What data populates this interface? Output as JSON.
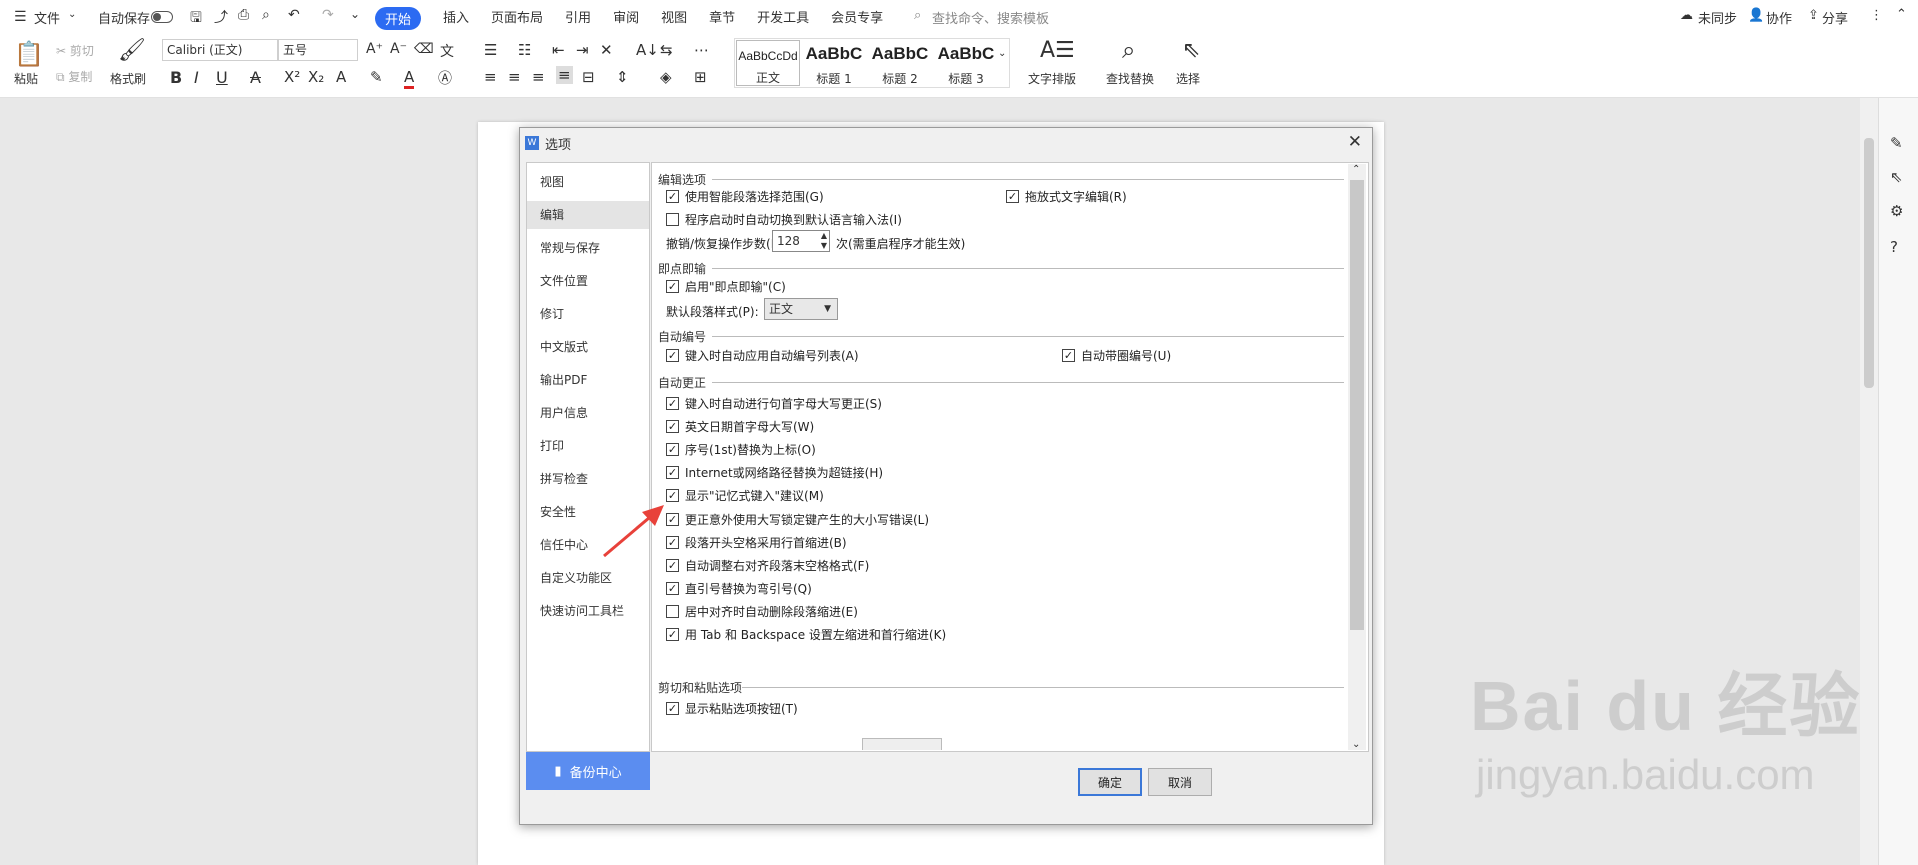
{
  "topbar": {
    "file": "文件",
    "autosave": "自动保存",
    "tabs": [
      "开始",
      "插入",
      "页面布局",
      "引用",
      "审阅",
      "视图",
      "章节",
      "开发工具",
      "会员专享"
    ],
    "search_placeholder": "查找命令、搜索模板",
    "sync": "未同步",
    "collab": "协作",
    "share": "分享"
  },
  "ribbon": {
    "paste": "粘贴",
    "cut": "剪切",
    "copy": "复制",
    "format_painter": "格式刷",
    "font": "Calibri (正文)",
    "size": "五号",
    "styles": [
      {
        "sample": "AaBbCcDd",
        "label": "正文"
      },
      {
        "sample": "AaBbC",
        "label": "标题 1"
      },
      {
        "sample": "AaBbC",
        "label": "标题 2"
      },
      {
        "sample": "AaBbC",
        "label": "标题 3"
      }
    ],
    "text_layout": "文字排版",
    "find_replace": "查找替换",
    "select": "选择"
  },
  "dialog": {
    "title": "选项",
    "nav": [
      "视图",
      "编辑",
      "常规与保存",
      "文件位置",
      "修订",
      "中文版式",
      "输出PDF",
      "用户信息",
      "打印",
      "拼写检查",
      "安全性",
      "信任中心",
      "自定义功能区",
      "快速访问工具栏"
    ],
    "backup": "备份中心",
    "sections": {
      "edit": "编辑选项",
      "click_type": "即点即输",
      "auto_number": "自动编号",
      "auto_correct": "自动更正",
      "cut_paste": "剪切和粘贴选项"
    },
    "edit_options": {
      "smart_select": "使用智能段落选择范围(G)",
      "drag_drop": "拖放式文字编辑(R)",
      "auto_ime": "程序启动时自动切换到默认语言输入法(I)",
      "undo_label": "撤销/恢复操作步数(N):",
      "undo_value": "128",
      "undo_note": "次(需重启程序才能生效)"
    },
    "click_type": {
      "enable": "启用\"即点即输\"(C)",
      "style_label": "默认段落样式(P):",
      "style_value": "正文"
    },
    "auto_number": {
      "apply_list": "键入时自动应用自动编号列表(A)",
      "circle_number": "自动带圈编号(U)"
    },
    "auto_correct": [
      {
        "label": "键入时自动进行句首字母大写更正(S)",
        "checked": true
      },
      {
        "label": "英文日期首字母大写(W)",
        "checked": true
      },
      {
        "label": "序号(1st)替换为上标(O)",
        "checked": true
      },
      {
        "label": "Internet或网络路径替换为超链接(H)",
        "checked": true
      },
      {
        "label": "显示\"记忆式键入\"建议(M)",
        "checked": true
      },
      {
        "label": "更正意外使用大写锁定键产生的大小写错误(L)",
        "checked": true
      },
      {
        "label": "段落开头空格采用行首缩进(B)",
        "checked": true
      },
      {
        "label": "自动调整右对齐段落末空格格式(F)",
        "checked": true
      },
      {
        "label": "直引号替换为弯引号(Q)",
        "checked": true
      },
      {
        "label": "居中对齐时自动删除段落缩进(E)",
        "checked": false
      },
      {
        "label": "用 Tab 和 Backspace 设置左缩进和首行缩进(K)",
        "checked": true
      }
    ],
    "cut_paste": {
      "show_paste_btn": "显示粘贴选项按钮(T)"
    },
    "ok": "确定",
    "cancel": "取消"
  },
  "watermark": {
    "logo": "Bai du 经验",
    "url": "jingyan.baidu.com"
  },
  "colors": {
    "accent": "#2c6bf2",
    "arrow": "#e8413a",
    "backup": "#5b8df0"
  }
}
